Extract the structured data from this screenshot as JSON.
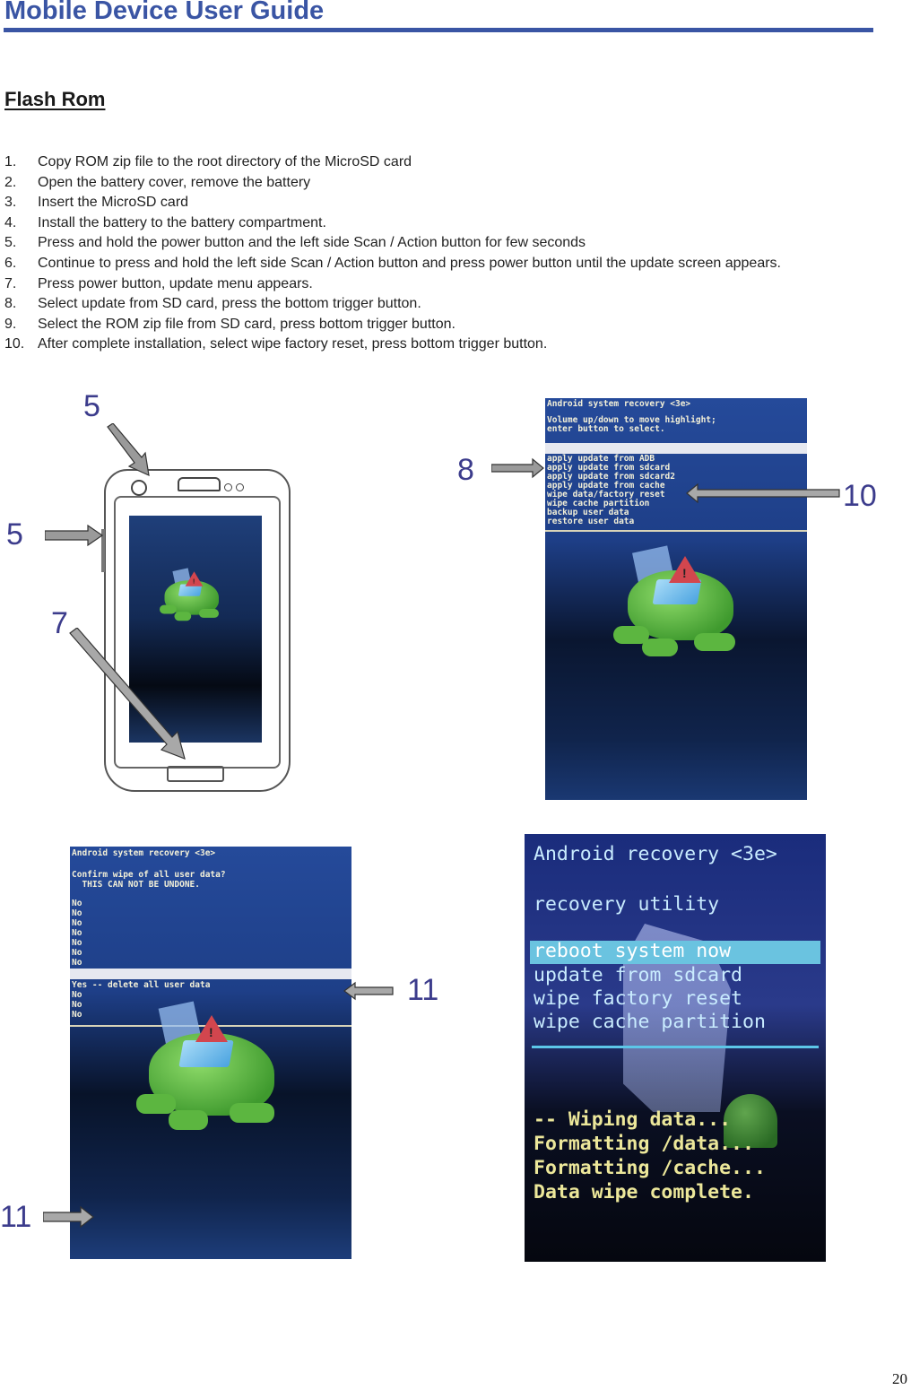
{
  "header": {
    "title": "Mobile Device User Guide",
    "accent_color": "#3a55a4"
  },
  "section": {
    "title": "Flash Rom"
  },
  "steps": [
    {
      "num": "1.",
      "text": "Copy ROM zip file to the root directory of the MicroSD card"
    },
    {
      "num": "2.",
      "text": "Open the battery cover, remove the battery"
    },
    {
      "num": "3.",
      "text": "Insert the MicroSD card"
    },
    {
      "num": "4.",
      "text": "Install the battery to the battery compartment."
    },
    {
      "num": "5.",
      "text": "Press and hold the power button and the left side Scan / Action button for few seconds"
    },
    {
      "num": "6.",
      "text": "Continue to press and hold the left side Scan / Action button and press power button until the update screen appears."
    },
    {
      "num": "7.",
      "text": "Press power button, update menu appears."
    },
    {
      "num": "8.",
      "text": "Select update from SD card, press the bottom trigger button."
    },
    {
      "num": "9.",
      "text": "Select the ROM zip file from SD card, press bottom trigger button."
    },
    {
      "num": "10.",
      "text": "After complete installation, select wipe factory reset, press bottom trigger button."
    }
  ],
  "figures": {
    "device": {
      "callouts": [
        "5",
        "5",
        "7"
      ]
    },
    "recovery_menu": {
      "title": "Android system recovery <3e>",
      "instructions": [
        "Volume up/down to move highlight;",
        "enter button to select."
      ],
      "items": [
        "apply update from ADB",
        "apply update from sdcard",
        "apply update from sdcard2",
        "apply update from cache",
        "wipe data/factory reset",
        "wipe cache partition",
        "backup user data",
        "restore user data"
      ],
      "callouts": [
        "8",
        "10"
      ]
    },
    "confirm_wipe": {
      "title": "Android system recovery <3e>",
      "prompt": [
        "Confirm wipe of all user data?",
        "  THIS CAN NOT BE UNDONE."
      ],
      "options_top": [
        "No",
        "No",
        "No",
        "No",
        "No",
        "No",
        "No"
      ],
      "selected": "Yes -- delete all user data",
      "options_bottom": [
        "No",
        "No",
        "No"
      ],
      "callouts": [
        "11",
        "11"
      ]
    },
    "wipe_result": {
      "title": "Android recovery <3e>",
      "subtitle": "recovery utility",
      "items": [
        "reboot system now",
        "update from sdcard",
        "wipe factory reset",
        "wipe cache partition"
      ],
      "log": [
        "-- Wiping data...",
        "Formatting /data...",
        "Formatting /cache...",
        "Data wipe complete."
      ]
    }
  },
  "footer": {
    "page_number": "20"
  }
}
